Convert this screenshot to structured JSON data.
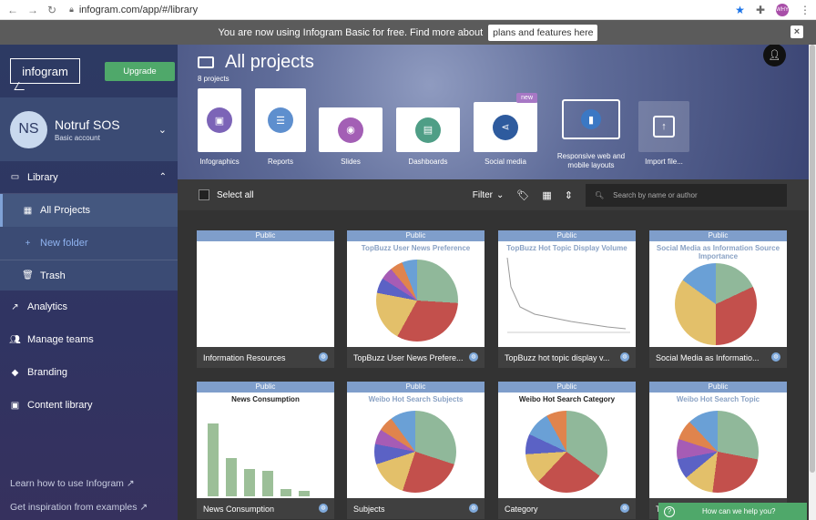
{
  "browser": {
    "url": "infogram.com/app/#/library",
    "profile_initials": "WHY"
  },
  "banner": {
    "text": "You are now using Infogram Basic for free. Find more about",
    "link": "plans and features here",
    "close": "×"
  },
  "sidebar": {
    "logo": "infogram",
    "upgrade": "Upgrade",
    "account": {
      "initials": "NS",
      "name": "Notruf SOS",
      "plan": "Basic account"
    },
    "library": "Library",
    "library_items": [
      {
        "label": "All Projects",
        "active": true
      },
      {
        "label": "New folder"
      }
    ],
    "trash": "Trash",
    "nav": [
      "Analytics",
      "Manage teams",
      "Branding",
      "Content library"
    ],
    "links": [
      "Learn how to use Infogram ↗",
      "Get inspiration from examples ↗"
    ]
  },
  "hero": {
    "title": "All projects",
    "count": "8 projects",
    "types": [
      {
        "label": "Infographics",
        "color": "#7c64b7"
      },
      {
        "label": "Reports",
        "color": "#5e8fce"
      },
      {
        "label": "Slides",
        "color": "#a35fb5"
      },
      {
        "label": "Dashboards",
        "color": "#4f9e86"
      },
      {
        "label": "Social media",
        "color": "#2e5b9e",
        "badge": "new"
      },
      {
        "label": "Responsive web and mobile layouts",
        "color": "#3b78c4"
      },
      {
        "label": "Import file...",
        "color": "#ffffff"
      }
    ]
  },
  "toolbar": {
    "select_all": "Select all",
    "filter": "Filter",
    "search_placeholder": "Search by name or author"
  },
  "projects": [
    {
      "badge": "Public",
      "name": "Information Resources",
      "thumb": ""
    },
    {
      "badge": "Public",
      "name": "TopBuzz User News Prefere...",
      "thumb": "TopBuzz User News Preference"
    },
    {
      "badge": "Public",
      "name": "TopBuzz hot topic display v...",
      "thumb": "TopBuzz Hot Topic Display Volume"
    },
    {
      "badge": "Public",
      "name": "Social Media as Informatio...",
      "thumb": "Social Media as Information Source Importance"
    },
    {
      "badge": "Public",
      "name": "News Consumption",
      "thumb": "News Consumption"
    },
    {
      "badge": "Public",
      "name": "Subjects",
      "thumb": "Weibo Hot Search Subjects"
    },
    {
      "badge": "Public",
      "name": "Category",
      "thumb": "Weibo Hot Search Category"
    },
    {
      "badge": "Public",
      "name": "T",
      "thumb": "Weibo Hot Search Topic"
    }
  ],
  "help": "How can we help you?"
}
